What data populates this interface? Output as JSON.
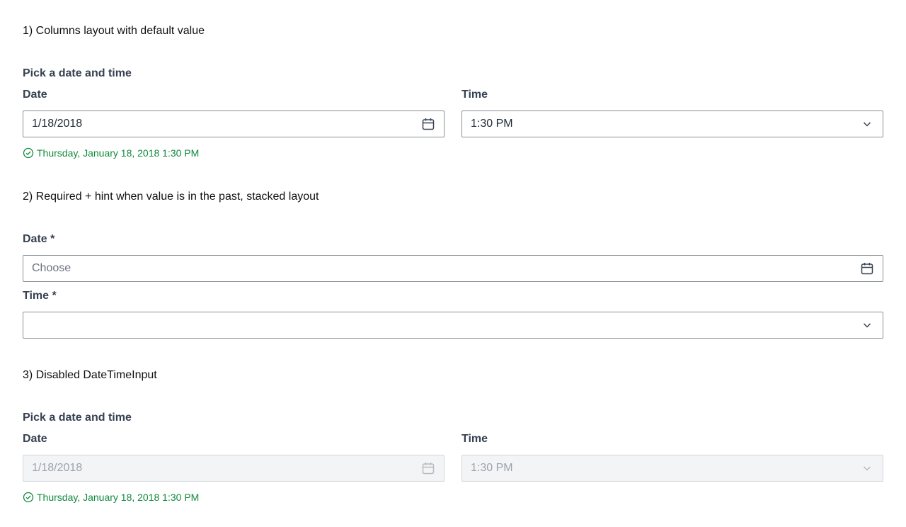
{
  "sections": [
    {
      "heading": "1) Columns layout with default value",
      "legend": "Pick a date and time",
      "date": {
        "label": "Date",
        "value": "1/18/2018",
        "icon": "calendar-icon"
      },
      "time": {
        "label": "Time",
        "value": "1:30 PM",
        "icon": "chevron-down-icon"
      },
      "hint": {
        "text": "Thursday, January 18, 2018 1:30 PM",
        "icon": "check-circle-icon",
        "color": "#0f8a3c"
      }
    },
    {
      "heading": "2) Required + hint when value is in the past, stacked layout",
      "date": {
        "label": "Date *",
        "placeholder": "Choose",
        "value": "",
        "icon": "calendar-icon"
      },
      "time": {
        "label": "Time *",
        "value": "",
        "icon": "chevron-down-icon"
      }
    },
    {
      "heading": "3) Disabled DateTimeInput",
      "legend": "Pick a date and time",
      "date": {
        "label": "Date",
        "value": "1/18/2018",
        "disabled": true,
        "icon": "calendar-icon"
      },
      "time": {
        "label": "Time",
        "value": "1:30 PM",
        "disabled": true,
        "icon": "chevron-down-icon"
      },
      "hint": {
        "text": "Thursday, January 18, 2018 1:30 PM",
        "icon": "check-circle-icon",
        "color": "#0f8a3c"
      }
    }
  ]
}
